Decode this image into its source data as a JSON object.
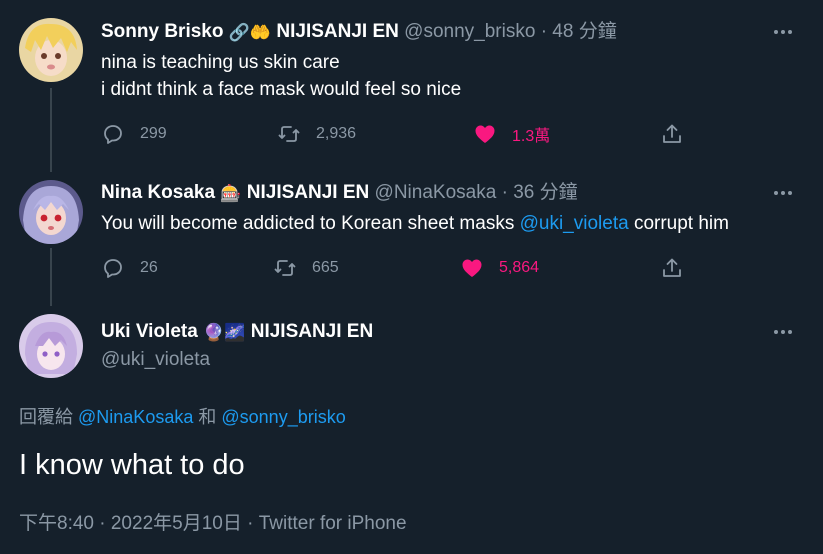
{
  "tweets": [
    {
      "name": "Sonny Brisko",
      "emojis": "🔗🤲",
      "org": "NIJISANJI EN",
      "handle": "@sonny_brisko",
      "time": "48 分鐘",
      "line1": "nina is teaching us skin care",
      "line2": "i didnt think a face mask would feel so nice",
      "replies": "299",
      "retweets": "2,936",
      "likes": "1.3萬"
    },
    {
      "name": "Nina Kosaka",
      "emojis": "🎰",
      "org": "NIJISANJI EN",
      "handle": "@NinaKosaka",
      "time": "36 分鐘",
      "text_pre": "You will become addicted to Korean sheet masks ",
      "mention": "@uki_violeta",
      "text_post": " corrupt him",
      "replies": "26",
      "retweets": "665",
      "likes": "5,864"
    }
  ],
  "main": {
    "name": "Uki Violeta",
    "emojis": "🔮🌌",
    "org": "NIJISANJI EN",
    "handle": "@uki_violeta",
    "replying_label": "回覆給",
    "replying_to_1": "@NinaKosaka",
    "replying_and": "和",
    "replying_to_2": "@sonny_brisko",
    "text": "I know what to do",
    "timestamp": "下午8:40 · 2022年5月10日 · Twitter for iPhone"
  },
  "dot": "·",
  "colors": {
    "background": "#15202b",
    "muted": "#8b98a5",
    "link": "#1d9bf0",
    "like": "#f91880"
  },
  "icons": [
    "reply-icon",
    "retweet-icon",
    "heart-icon",
    "share-icon",
    "more-icon"
  ]
}
